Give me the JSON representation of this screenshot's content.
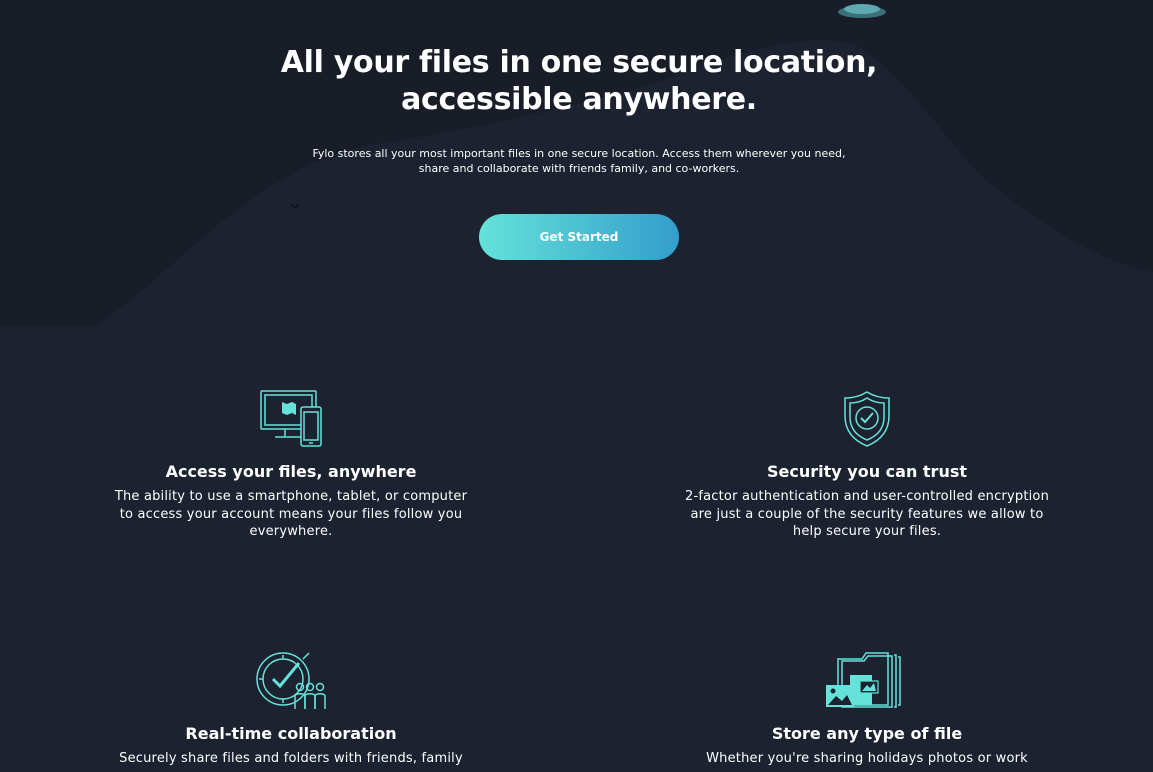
{
  "hero": {
    "title_line1": "All your files in one secure location,",
    "title_line2": "accessible anywhere.",
    "description_line1": "Fylo stores all your most important files in one secure location. Access them wherever you need,",
    "description_line2": "share and collaborate with friends family, and co-workers.",
    "cta_label": "Get Started"
  },
  "features": [
    {
      "icon": "devices-icon",
      "title": "Access your files, anywhere",
      "desc_lines": [
        "The ability to use a smartphone, tablet, or computer",
        "to access your account means your files follow you",
        "everywhere."
      ]
    },
    {
      "icon": "shield-check-icon",
      "title": "Security you can trust",
      "desc_lines": [
        "2-factor authentication and user-controlled encryption",
        "are just a couple of the security features we allow to",
        "help secure your files."
      ]
    },
    {
      "icon": "collaboration-icon",
      "title": "Real-time collaboration",
      "desc_lines": [
        "Securely share files and folders with friends, family"
      ]
    },
    {
      "icon": "file-types-icon",
      "title": "Store any type of file",
      "desc_lines": [
        "Whether you're sharing holidays photos or work"
      ]
    }
  ],
  "colors": {
    "background": "#1c2230",
    "curve": "#181d27",
    "accent_teal": "#65e2d9",
    "accent_blue": "#339ecc",
    "text": "#ffffff"
  }
}
